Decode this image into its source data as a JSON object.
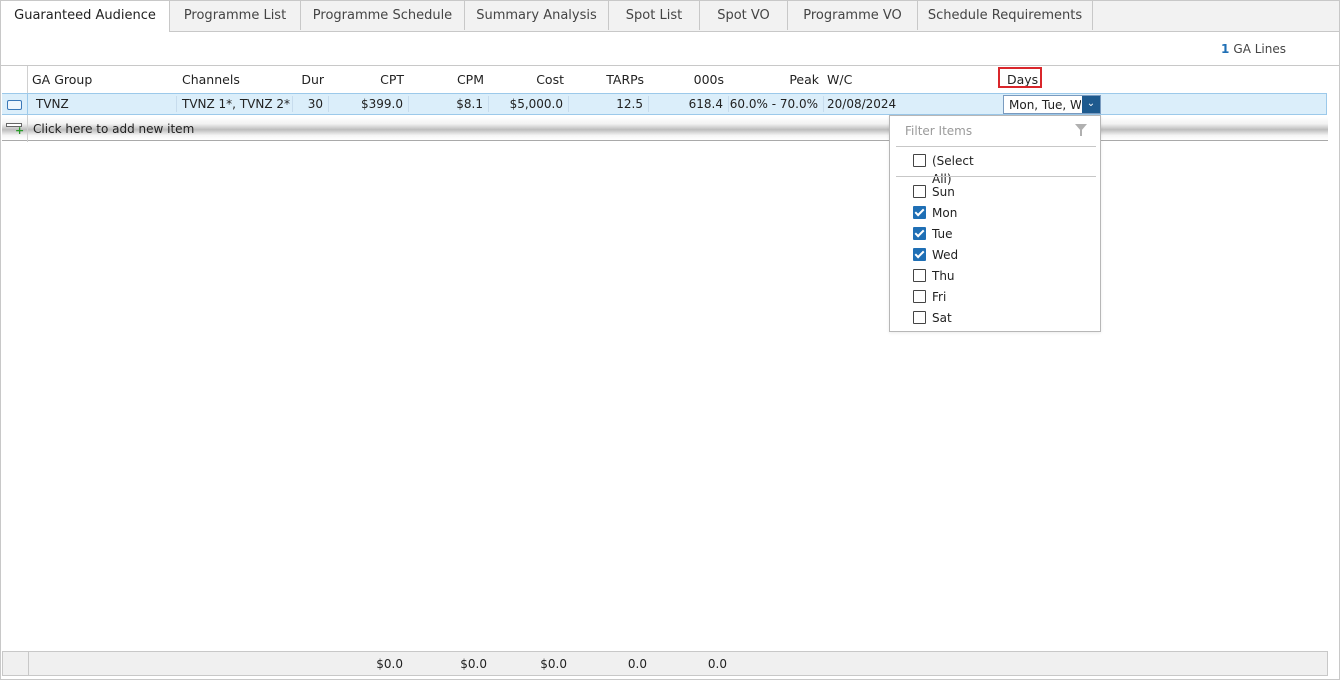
{
  "tabs": [
    {
      "label": "Guaranteed Audience",
      "active": true
    },
    {
      "label": "Programme List"
    },
    {
      "label": "Programme Schedule"
    },
    {
      "label": "Summary Analysis"
    },
    {
      "label": "Spot List"
    },
    {
      "label": "Spot VO"
    },
    {
      "label": "Programme VO"
    },
    {
      "label": "Schedule Requirements"
    }
  ],
  "ga_lines": {
    "count": "1",
    "label": "GA Lines"
  },
  "columns": {
    "ga_group": "GA Group",
    "channels": "Channels",
    "dur": "Dur",
    "cpt": "CPT",
    "cpm": "CPM",
    "cost": "Cost",
    "tarps": "TARPs",
    "thousands": "000s",
    "peak": "Peak",
    "wc": "W/C",
    "days": "Days"
  },
  "row": {
    "ga_group": "TVNZ",
    "channels": "TVNZ 1*, TVNZ 2*",
    "dur": "30",
    "cpt": "$399.0",
    "cpm": "$8.1",
    "cost": "$5,000.0",
    "tarps": "12.5",
    "thousands": "618.4",
    "peak": "60.0% - 70.0%",
    "wc": "20/08/2024",
    "days": "Mon, Tue, Wed"
  },
  "add_row_label": "Click here to add new item",
  "dropdown": {
    "filter_placeholder": "Filter Items",
    "select_all": "(Select All)",
    "options": [
      {
        "label": "Sun",
        "checked": false
      },
      {
        "label": "Mon",
        "checked": true
      },
      {
        "label": "Tue",
        "checked": true
      },
      {
        "label": "Wed",
        "checked": true
      },
      {
        "label": "Thu",
        "checked": false
      },
      {
        "label": "Fri",
        "checked": false
      },
      {
        "label": "Sat",
        "checked": false
      }
    ]
  },
  "totals": {
    "cpt": "$0.0",
    "cpm": "$0.0",
    "cost": "$0.0",
    "tarps": "0.0",
    "thousands": "0.0"
  },
  "colors": {
    "accent": "#1f6fb5",
    "selection": "#dbeefa",
    "highlight": "#d9262b"
  }
}
